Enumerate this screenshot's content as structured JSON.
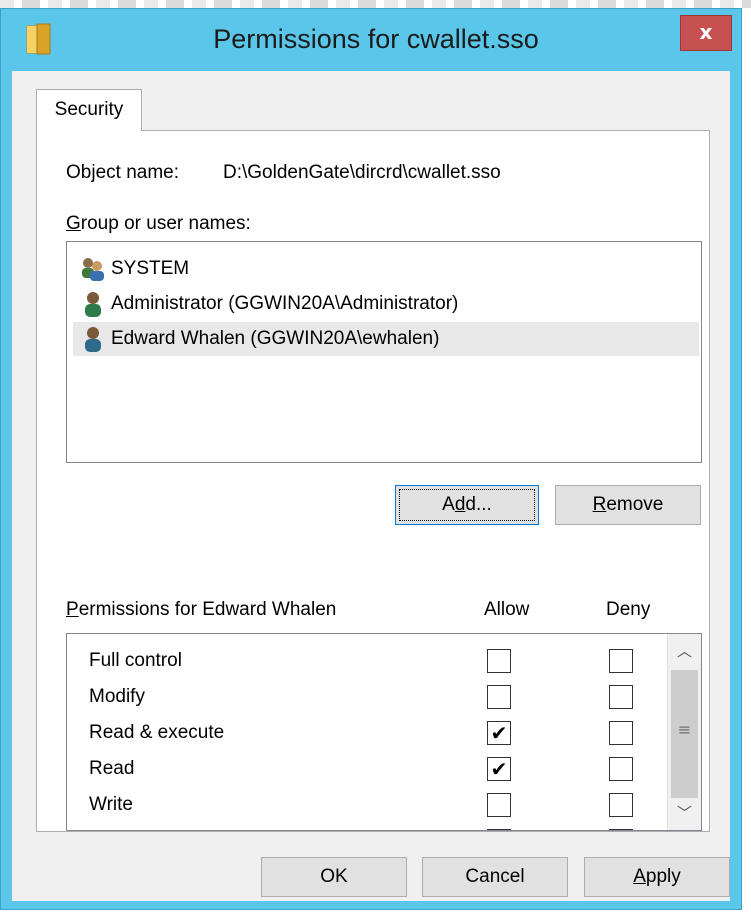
{
  "window": {
    "title": "Permissions for cwallet.sso",
    "close_label": "x",
    "accent_color": "#5ac6ea"
  },
  "tabs": [
    {
      "label": "Security"
    }
  ],
  "object": {
    "label": "Object name:",
    "value": "D:\\GoldenGate\\dircrd\\cwallet.sso"
  },
  "group_list": {
    "label_first_letter": "G",
    "label_rest": "roup or user names:",
    "items": [
      {
        "icon": "group-users-icon",
        "name": "SYSTEM",
        "selected": false
      },
      {
        "icon": "user-icon",
        "name": "Administrator (GGWIN20A\\Administrator)",
        "selected": false
      },
      {
        "icon": "user-icon",
        "name": "Edward Whalen (GGWIN20A\\ewhalen)",
        "selected": true
      }
    ]
  },
  "buttons": {
    "add_pre": "A",
    "add_mnemonic": "d",
    "add_post": "d...",
    "remove_mnemonic": "R",
    "remove_rest": "emove",
    "ok": "OK",
    "cancel": "Cancel",
    "apply_mnemonic": "A",
    "apply_rest": "pply"
  },
  "permissions": {
    "header_mnemonic": "P",
    "header_rest": "ermissions for Edward Whalen",
    "allow_header": "Allow",
    "deny_header": "Deny",
    "rows": [
      {
        "name": "Full control",
        "allow": false,
        "deny": false
      },
      {
        "name": "Modify",
        "allow": false,
        "deny": false
      },
      {
        "name": "Read & execute",
        "allow": true,
        "deny": false
      },
      {
        "name": "Read",
        "allow": true,
        "deny": false
      },
      {
        "name": "Write",
        "allow": false,
        "deny": false
      }
    ],
    "check_glyph": "✔",
    "scroll_up": "︿",
    "scroll_down": "﹀",
    "scroll_grip": "≡"
  }
}
